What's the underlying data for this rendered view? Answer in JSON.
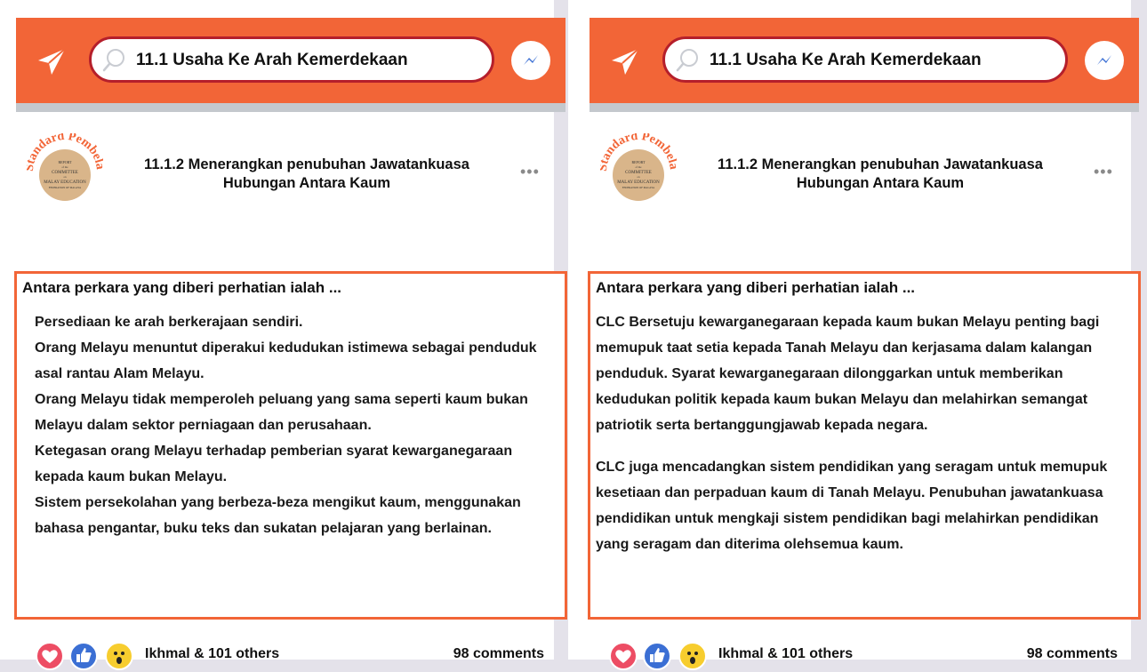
{
  "header": {
    "search_text": "11.1 Usaha Ke Arah Kemerdekaan",
    "accent_color": "#f26537",
    "search_border_color": "#b51f2b"
  },
  "post": {
    "avatar_ring_text": "Standard Pembelajaran",
    "avatar_lines": [
      "REPORT",
      "of the",
      "COMMITTEE",
      "on",
      "MALAY EDUCATION",
      "FEDERATION OF MALAYA"
    ],
    "title_line1": "11.1.2 Menerangkan penubuhan Jawatankuasa",
    "title_line2": "Hubungan Antara Kaum",
    "more_label": "•••"
  },
  "left": {
    "heading": "Antara perkara yang diberi perhatian ialah ...",
    "lines": [
      "Persediaan ke arah berkerajaan sendiri.",
      "Orang Melayu menuntut diperakui kedudukan istimewa sebagai penduduk",
      "asal rantau Alam Melayu.",
      "Orang Melayu tidak memperoleh peluang yang sama seperti kaum bukan",
      "Melayu dalam sektor perniagaan dan perusahaan.",
      "Ketegasan orang Melayu terhadap pemberian syarat kewarganegaraan",
      "kepada kaum bukan Melayu.",
      "Sistem persekolahan yang berbeza-beza mengikut kaum, menggunakan",
      "bahasa pengantar, buku teks dan sukatan pelajaran yang berlainan."
    ]
  },
  "right": {
    "heading": "Antara perkara yang diberi perhatian ialah ...",
    "paragraphs": [
      "CLC Bersetuju kewarganegaraan kepada kaum bukan Melayu penting bagi memupuk taat setia kepada Tanah Melayu dan kerjasama dalam kalangan penduduk. Syarat kewarganegaraan dilonggarkan untuk memberikan kedudukan politik kepada kaum bukan Melayu dan melahirkan semangat patriotik serta bertanggungjawab kepada negara.",
      "CLC juga mencadangkan sistem pendidikan yang seragam untuk memupuk kesetiaan dan perpaduan kaum di Tanah Melayu. Penubuhan jawatankuasa pendidikan untuk mengkaji sistem pendidikan bagi melahirkan pendidikan yang seragam dan diterima olehsemua kaum."
    ]
  },
  "footer": {
    "reactions_text": "Ikhmal &  101 others",
    "comments_text": "98 comments"
  }
}
